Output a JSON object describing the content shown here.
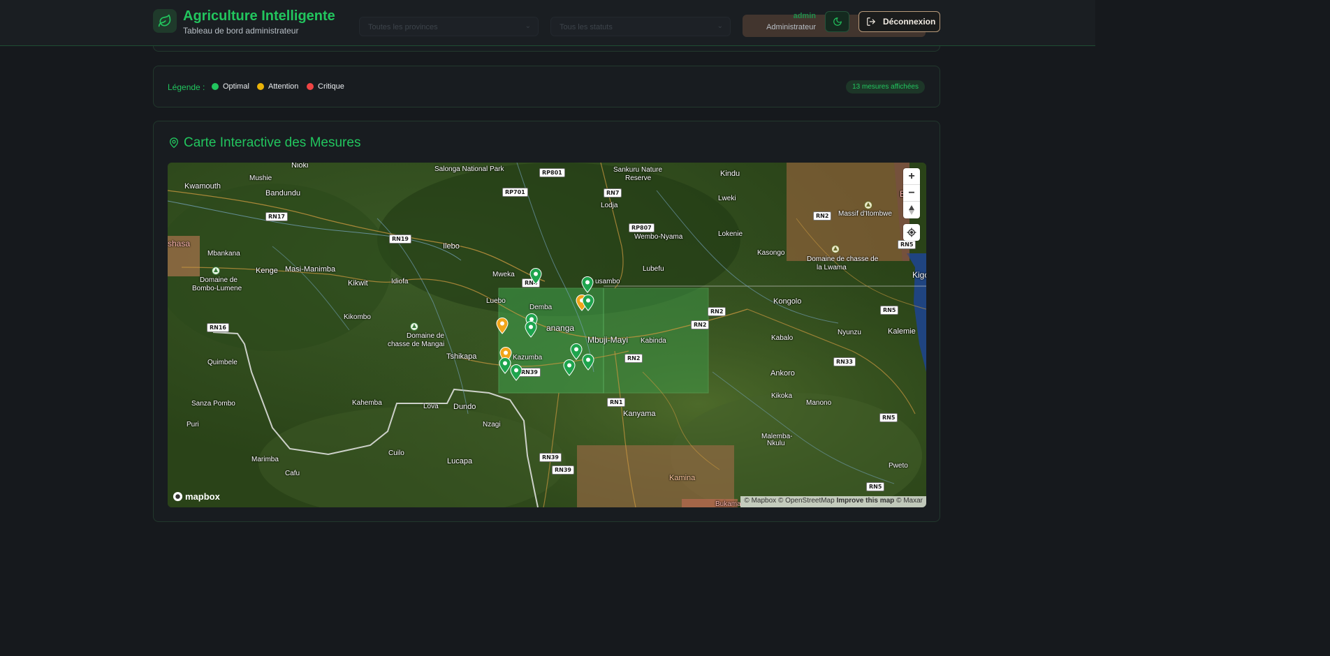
{
  "header": {
    "brand_icon": "leaf-icon",
    "title": "Agriculture Intelligente",
    "subtitle": "Tableau de bord administrateur",
    "filter_province_placeholder": "Toutes les provinces",
    "filter_status_placeholder": "Tous les statuts",
    "user": {
      "name": "admin",
      "role": "Administrateur"
    },
    "theme_icon": "moon-icon",
    "logout_label": "Déconnexion",
    "logout_icon": "logout-icon"
  },
  "legend": {
    "label": "Légende :",
    "items": [
      {
        "label": "Optimal",
        "color": "#22c55e"
      },
      {
        "label": "Attention",
        "color": "#eab308"
      },
      {
        "label": "Critique",
        "color": "#ef4444"
      }
    ],
    "count_text": "13 mesures affichées"
  },
  "map_card": {
    "title": "Carte Interactive des Mesures",
    "title_icon": "map-pin-icon"
  },
  "map": {
    "places": {
      "salonga": "Salonga National Park",
      "sankuru": "Sankuru Nature",
      "sankuru2": "Reserve",
      "kindu": "Kindu",
      "kwamouth": "Kwamouth",
      "mushie": "Mushie",
      "bandundu": "Bandundu",
      "lodja": "Lodja",
      "lweki": "Lweki",
      "massif": "Massif d'Itombwe",
      "wembo": "Wembo-Nyama",
      "lokenie": "Lokenie",
      "kasongo": "Kasongo",
      "chasse_lwama": "Domaine de chasse de",
      "chasse_lwama2": "la Lwama",
      "kinshasa": "shasa",
      "mbankana": "Mbankana",
      "kenge": "Kenge",
      "masi": "Masi-Manimba",
      "ilebo": "Ilebo",
      "mweka": "Mweka",
      "lubefu": "Lubefu",
      "bombo": "Domaine de",
      "bombo2": "Bombo-Lumene",
      "kikwit": "Kikwit",
      "idiofa": "Idiofa",
      "kigoma": "Kigo",
      "luebo": "Luebo",
      "demba": "Demba",
      "lusambo": "usambo",
      "kongolo": "Kongolo",
      "kikombo": "Kikombo",
      "mangai": "Domaine de",
      "mangai2": "chasse de Mangai",
      "kananga": "ananga",
      "mbuji": "Mbuji-Mayi",
      "kabinda": "Kabinda",
      "kabalo": "Kabalo",
      "nyunzu": "Nyunzu",
      "kalemie": "Kalemie",
      "tshikapa": "Tshikapa",
      "kazumba": "Kazumba",
      "quimbele": "Quimbele",
      "ankoro": "Ankoro",
      "sanza": "Sanza Pombo",
      "kahemba": "Kahemba",
      "lova": "Lova",
      "dundo": "Dundo",
      "kanyama": "Kanyama",
      "kikoka": "Kikoka",
      "manono": "Manono",
      "puri": "Puri",
      "nzagi": "Nzagi",
      "cuilo": "Cuilo",
      "malemba": "Malemba-",
      "malemba2": "Nkulu",
      "marimba": "Marimba",
      "lucapa": "Lucapa",
      "kamina": "Kamina",
      "pweto": "Pweto",
      "cafu": "Cafu",
      "bukama": "Bukama",
      "buj": "Buj",
      "nioki": "Nioki"
    },
    "shields": [
      "RP801",
      "RN7",
      "RP701",
      "RN17",
      "RN19",
      "RP807",
      "RN4",
      "RN2",
      "RN2",
      "RN5",
      "RN16",
      "RN2",
      "RN5",
      "RN39",
      "RN33",
      "RN1",
      "RN5",
      "RN39",
      "RN39",
      "RN5",
      "RN2"
    ],
    "marker_colors": {
      "optimal": "#1ea44d",
      "attention": "#f0a51a"
    },
    "controls": {
      "zoom_in": "+",
      "zoom_out": "−",
      "compass_icon": "compass-icon",
      "locate_icon": "locate-icon"
    },
    "logo": "mapbox",
    "attribution": {
      "mapbox": "© Mapbox",
      "osm": "© OpenStreetMap",
      "improve": "Improve this map",
      "maxar": "© Maxar"
    }
  }
}
